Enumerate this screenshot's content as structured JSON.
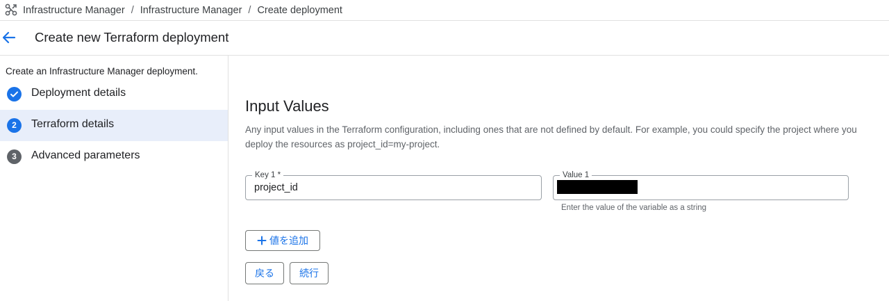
{
  "breadcrumb": {
    "logo_icon": "infrastructure-manager-icon",
    "items": [
      "Infrastructure Manager",
      "Infrastructure Manager",
      "Create deployment"
    ],
    "separator": "/"
  },
  "header": {
    "back_icon": "arrow-back-icon",
    "title": "Create new Terraform deployment"
  },
  "stepper": {
    "intro": "Create an Infrastructure Manager deployment.",
    "steps": [
      {
        "number": "",
        "label": "Deployment details",
        "state": "done"
      },
      {
        "number": "2",
        "label": "Terraform details",
        "state": "current"
      },
      {
        "number": "3",
        "label": "Advanced parameters",
        "state": "pending"
      }
    ]
  },
  "main": {
    "section_title": "Input Values",
    "section_description": "Any input values in the Terraform configuration, including ones that are not defined by default. For example, you could specify the project where you deploy the resources as project_id=my-project.",
    "key_field": {
      "label": "Key 1 *",
      "value": "project_id"
    },
    "value_field": {
      "label": "Value 1",
      "value": "",
      "redacted": true,
      "hint": "Enter the value of the variable as a string"
    },
    "add_button": {
      "icon": "plus-icon",
      "label": "値を追加"
    },
    "back_button": {
      "label": "戻る"
    },
    "continue_button": {
      "label": "続行"
    }
  },
  "colors": {
    "accent": "#1a73e8",
    "active_step_bg": "#e8eefa",
    "pending_step": "#5f6368",
    "border": "#e0e0e0"
  }
}
